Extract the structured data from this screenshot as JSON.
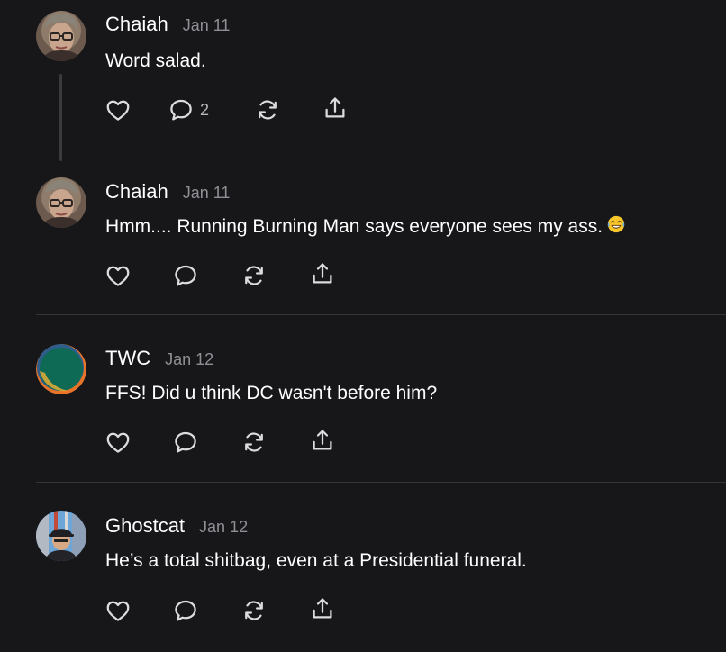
{
  "comments": [
    {
      "author": "Chaiah",
      "date": "Jan 11",
      "text": "Word salad.",
      "reply_count": "2",
      "avatar": "woman-with-glasses-photo"
    },
    {
      "author": "Chaiah",
      "date": "Jan 11",
      "text": "Hmm.... Running Burning Man says everyone sees my ass.",
      "emoji": "face-with-tears-of-joy",
      "avatar": "woman-with-glasses-photo"
    },
    {
      "author": "TWC",
      "date": "Jan 12",
      "text": "FFS! Did u think DC wasn't before him?",
      "avatar": "green-orange-logo"
    },
    {
      "author": "Ghostcat",
      "date": "Jan 12",
      "text": "He’s a total shitbag, even at a Presidential funeral.",
      "avatar": "man-with-cap-photo"
    }
  ],
  "actions": [
    "heart-icon",
    "comment-icon",
    "restack-icon",
    "share-icon"
  ],
  "colors": {
    "background": "#17171a",
    "text": "#ffffff",
    "muted": "#8f8f95",
    "divider": "#333338"
  }
}
